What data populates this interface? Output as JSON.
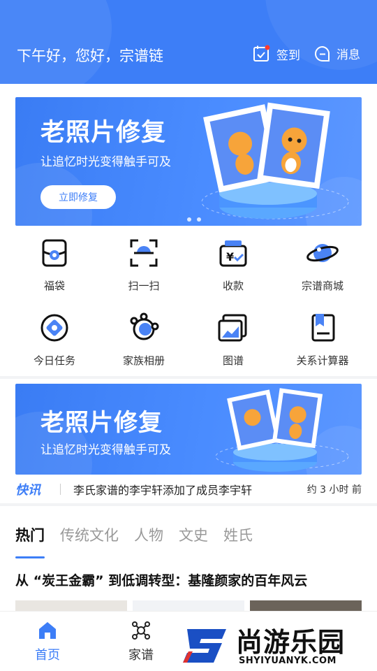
{
  "header": {
    "greeting": "下午好，您好，宗谱链",
    "signin_label": "签到",
    "message_label": "消息",
    "signin_badge_color": "#ff3b30"
  },
  "banner_top": {
    "title": "老照片修复",
    "subtitle": "让追忆时光变得触手可及",
    "button_label": "立即修复",
    "page_count": 2
  },
  "grid": [
    {
      "label": "福袋",
      "icon": "lucky-bag-icon"
    },
    {
      "label": "扫一扫",
      "icon": "scan-icon"
    },
    {
      "label": "收款",
      "icon": "payment-icon"
    },
    {
      "label": "宗谱商城",
      "icon": "planet-mall-icon"
    },
    {
      "label": "今日任务",
      "icon": "task-icon"
    },
    {
      "label": "家族相册",
      "icon": "family-album-icon"
    },
    {
      "label": "图谱",
      "icon": "pedigree-chart-icon"
    },
    {
      "label": "关系计算器",
      "icon": "relation-calculator-icon"
    }
  ],
  "banner_mid": {
    "title": "老照片修复",
    "subtitle": "让追忆时光变得触手可及"
  },
  "news": {
    "tag": "快讯",
    "text": "李氏家谱的李宇轩添加了成员李宇轩",
    "time": "约 3 小时 前"
  },
  "tabs": [
    "热门",
    "传统文化",
    "人物",
    "文史",
    "姓氏"
  ],
  "article": {
    "title": "从 “炭王金霸” 到低调转型：基隆颜家的百年风云"
  },
  "bottom_nav": {
    "home_label": "首页",
    "tree_label": "家谱"
  },
  "watermark": {
    "name": "尚游乐园",
    "url": "SHYIYUANYK.COM"
  },
  "colors": {
    "primary": "#3d7ef7",
    "accent_icon": "#4a83f5"
  }
}
